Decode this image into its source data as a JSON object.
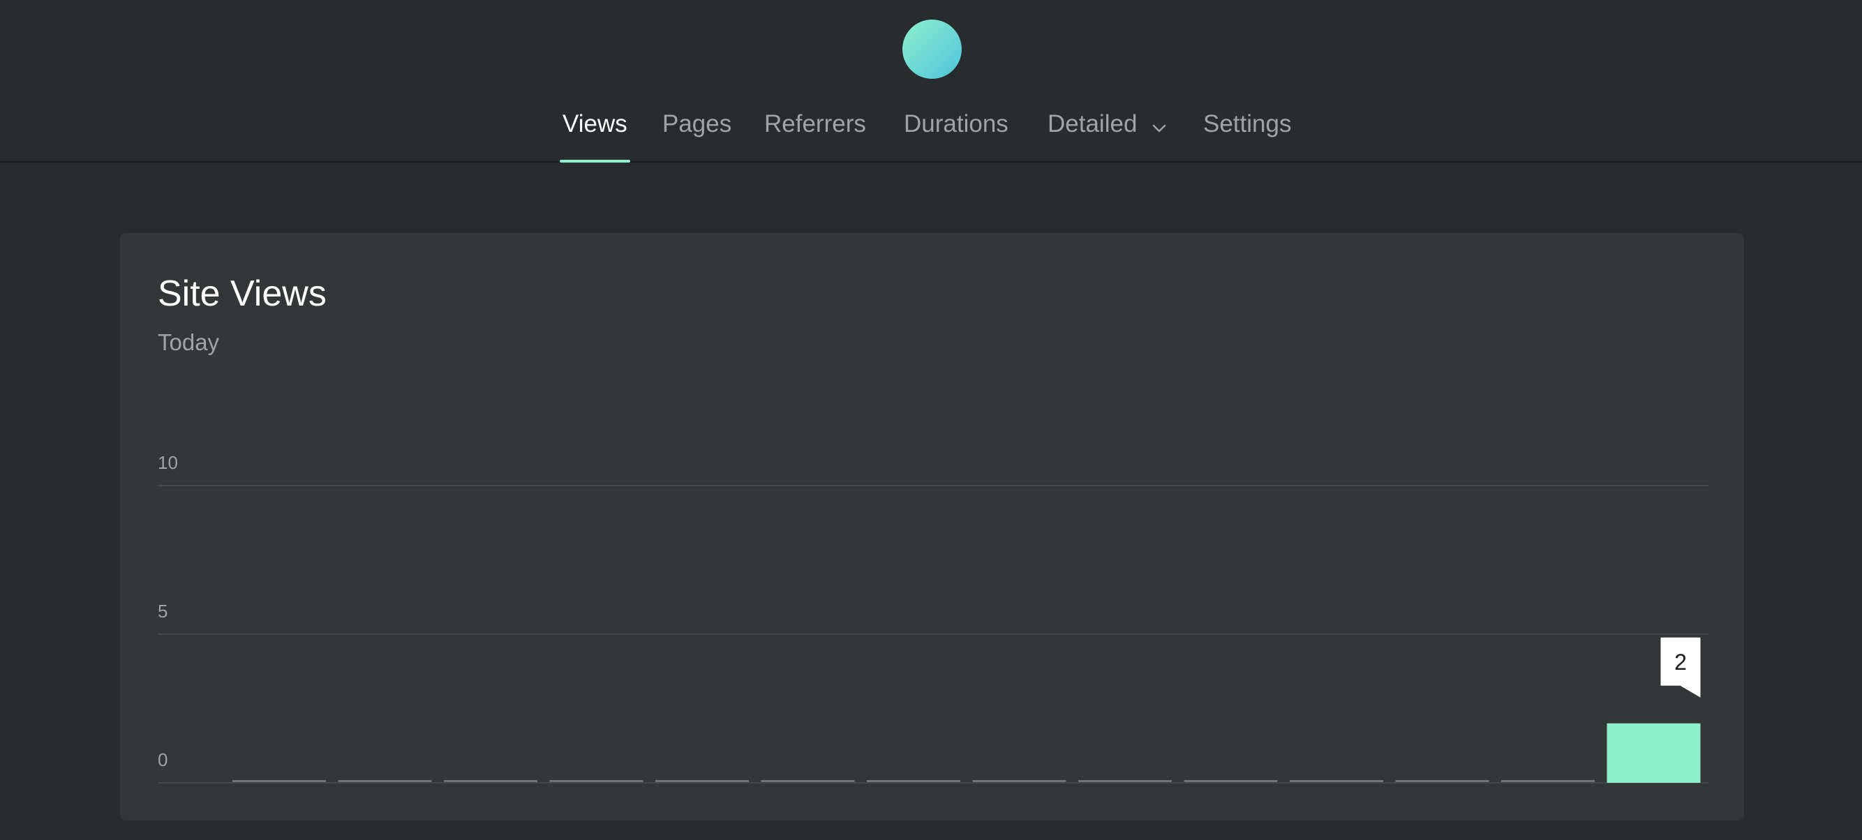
{
  "header": {
    "nav": [
      {
        "label": "Views",
        "active": true
      },
      {
        "label": "Pages",
        "active": false
      },
      {
        "label": "Referrers",
        "active": false
      },
      {
        "label": "Durations",
        "active": false
      },
      {
        "label": "Detailed",
        "active": false,
        "dropdown": true
      },
      {
        "label": "Settings",
        "active": false
      }
    ]
  },
  "card": {
    "title": "Site Views",
    "subtitle": "Today"
  },
  "colors": {
    "accent": "#8ef0cc",
    "background": "#292c2e",
    "card": "#343738"
  },
  "chart_data": {
    "type": "bar",
    "title": "Site Views",
    "subtitle": "Today",
    "ylim": [
      0,
      10
    ],
    "yticks": [
      0,
      5,
      10
    ],
    "values": [
      0,
      0,
      0,
      0,
      0,
      0,
      0,
      0,
      0,
      0,
      0,
      0,
      0,
      2
    ],
    "data_labels": [
      {
        "index": 13,
        "text": "2"
      }
    ],
    "grid": true
  }
}
